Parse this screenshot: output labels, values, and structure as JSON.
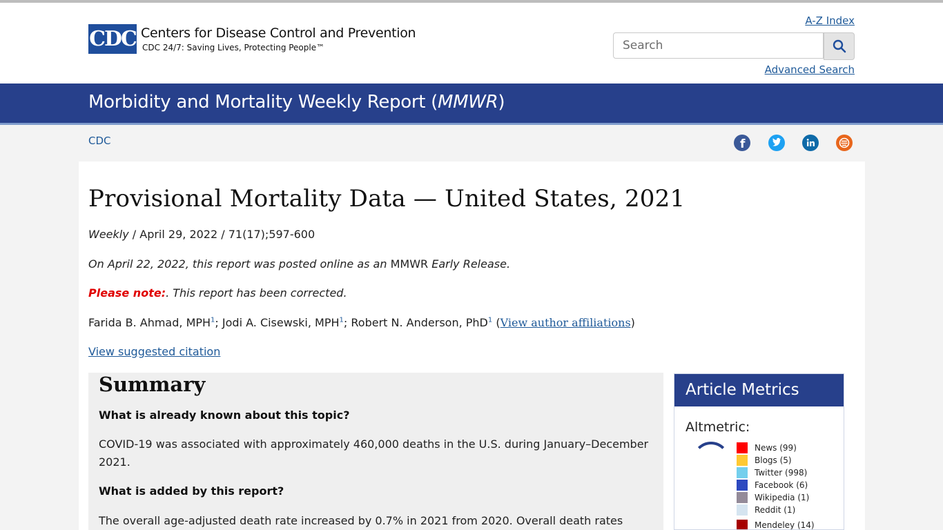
{
  "header": {
    "logo_text": "CDC",
    "org_name": "Centers for Disease Control and Prevention",
    "tagline": "CDC 24/7: Saving Lives, Protecting People™",
    "az_index": "A-Z Index",
    "search_placeholder": "Search",
    "advanced_search": "Advanced Search"
  },
  "banner": {
    "title_prefix": "Morbidity and Mortality Weekly Report (",
    "title_em": "MMWR",
    "title_suffix": ")"
  },
  "breadcrumb": {
    "home": "CDC"
  },
  "social": [
    {
      "name": "facebook-icon",
      "color": "#3b5998"
    },
    {
      "name": "twitter-icon",
      "color": "#1da1f2"
    },
    {
      "name": "linkedin-icon",
      "color": "#0e6aa8"
    },
    {
      "name": "syndication-icon",
      "color": "#e8661c"
    }
  ],
  "article": {
    "title": "Provisional Mortality Data — United States, 2021",
    "meta_em": "Weekly",
    "meta_rest": " / April 29, 2022 / 71(17);597-600",
    "early_part1": "On April 22, 2022, this report was posted online as an ",
    "early_mmwr": "MMWR",
    "early_part2": " Early Release.",
    "note_label": "Please note:",
    "note_text": ". This report has been corrected.",
    "author1": "Farida B. Ahmad, MPH",
    "author2": "Jodi A. Cisewski, MPH",
    "author3": "Robert N. Anderson, PhD",
    "sup": "1",
    "sep": "; ",
    "aff_open": " (",
    "aff_link": "View author affiliations",
    "aff_close": ")",
    "citation": "View suggested citation"
  },
  "summary": {
    "heading": "Summary",
    "q1": "What is already known about this topic?",
    "a1": "COVID-19 was associated with approximately 460,000 deaths in the U.S. during January–December 2021.",
    "q2": "What is added by this report?",
    "a2": "The overall age-adjusted death rate increased by 0.7% in 2021 from 2020. Overall death rates were"
  },
  "metrics": {
    "heading": "Article Metrics",
    "altmetric_label": "Altmetric:",
    "legend": [
      {
        "label": "News (99)",
        "color": "#ff0000"
      },
      {
        "label": "Blogs (5)",
        "color": "#ffc933"
      },
      {
        "label": "Twitter (998)",
        "color": "#74cfed"
      },
      {
        "label": "Facebook (6)",
        "color": "#2d49c0"
      },
      {
        "label": "Wikipedia (1)",
        "color": "#948b99"
      },
      {
        "label": "Reddit (1)",
        "color": "#d5e4f0"
      },
      {
        "label": "Mendeley (14)",
        "color": "#a60000"
      }
    ]
  }
}
